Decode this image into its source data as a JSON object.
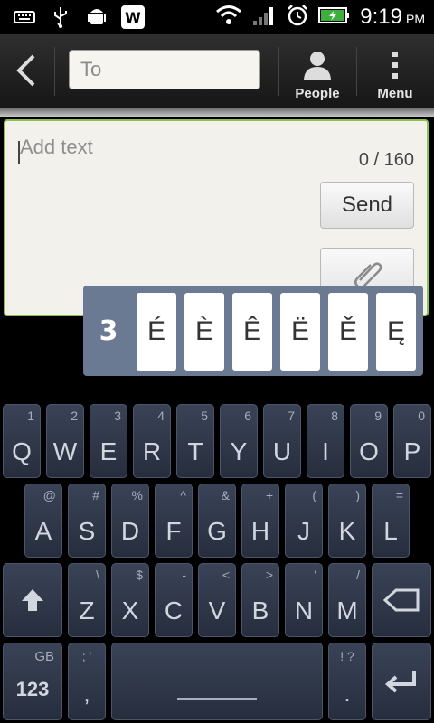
{
  "status": {
    "time": "9:19",
    "ampm": "PM",
    "w_badge": "W"
  },
  "actionbar": {
    "to_placeholder": "To",
    "people_label": "People",
    "menu_label": "Menu"
  },
  "compose": {
    "placeholder": "Add text",
    "counter": "0 / 160",
    "send_label": "Send"
  },
  "accent_popup": {
    "number": "3",
    "keys": [
      "É",
      "È",
      "Ê",
      "Ë",
      "Ě",
      "Ę"
    ]
  },
  "keyboard": {
    "row1": [
      {
        "main": "Q",
        "hint": "1"
      },
      {
        "main": "W",
        "hint": "2"
      },
      {
        "main": "E",
        "hint": "3"
      },
      {
        "main": "R",
        "hint": "4"
      },
      {
        "main": "T",
        "hint": "5"
      },
      {
        "main": "Y",
        "hint": "6"
      },
      {
        "main": "U",
        "hint": "7"
      },
      {
        "main": "I",
        "hint": "8"
      },
      {
        "main": "O",
        "hint": "9"
      },
      {
        "main": "P",
        "hint": "0"
      }
    ],
    "row2": [
      {
        "main": "A",
        "hint": "@"
      },
      {
        "main": "S",
        "hint": "#"
      },
      {
        "main": "D",
        "hint": "%"
      },
      {
        "main": "F",
        "hint": "^"
      },
      {
        "main": "G",
        "hint": "&"
      },
      {
        "main": "H",
        "hint": "+"
      },
      {
        "main": "J",
        "hint": "("
      },
      {
        "main": "K",
        "hint": ")"
      },
      {
        "main": "L",
        "hint": "="
      }
    ],
    "row3": [
      {
        "main": "Z",
        "hint": "\\"
      },
      {
        "main": "X",
        "hint": "$"
      },
      {
        "main": "C",
        "hint": "-"
      },
      {
        "main": "V",
        "hint": "<"
      },
      {
        "main": "B",
        "hint": ">"
      },
      {
        "main": "N",
        "hint": "'"
      },
      {
        "main": "M",
        "hint": "/"
      }
    ],
    "lang_label": "GB",
    "numbers_label": "123",
    "comma_main": ",",
    "comma_hint": "; '",
    "period_main": ".",
    "period_hint": "! ?"
  }
}
